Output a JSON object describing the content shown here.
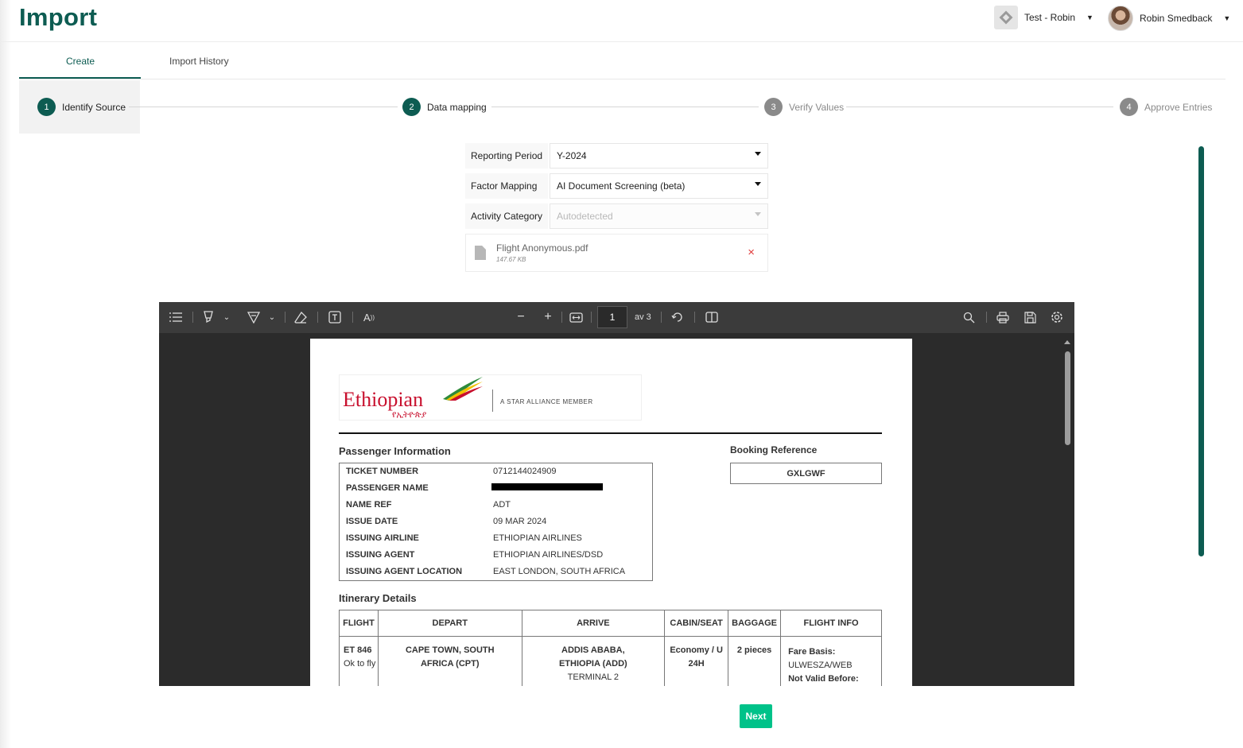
{
  "app": {
    "title": "Import"
  },
  "header": {
    "tenant": "Test - Robin",
    "user": "Robin Smedback"
  },
  "tabs": [
    {
      "label": "Create",
      "active": true
    },
    {
      "label": "Import History",
      "active": false
    }
  ],
  "steps": [
    {
      "number": "1",
      "label": "Identify Source",
      "state": "done"
    },
    {
      "number": "2",
      "label": "Data mapping",
      "state": "done"
    },
    {
      "number": "3",
      "label": "Verify Values",
      "state": "todo"
    },
    {
      "number": "4",
      "label": "Approve Entries",
      "state": "todo"
    }
  ],
  "form": {
    "reporting_period": {
      "label": "Reporting Period",
      "value": "Y-2024"
    },
    "factor_mapping": {
      "label": "Factor Mapping",
      "value": "AI Document Screening (beta)"
    },
    "activity_category": {
      "label": "Activity Category",
      "placeholder": "Autodetected"
    }
  },
  "file": {
    "name": "Flight Anonymous.pdf",
    "size": "147.67 KB",
    "remove_icon": "×"
  },
  "viewer": {
    "page_number": "1",
    "page_total": "av 3",
    "icons": [
      "list-icon",
      "highlight-icon",
      "draw-icon",
      "eraser-icon",
      "text-box-icon",
      "read-aloud-icon",
      "zoom-out-icon",
      "zoom-in-icon",
      "fit-width-icon",
      "rotate-icon",
      "two-page-icon",
      "search-icon",
      "print-icon",
      "save-icon",
      "settings-icon"
    ]
  },
  "document": {
    "logo_name": "Ethiopian",
    "logo_amharic": "የኢትዮጵያ",
    "logo_tagline": "A STAR ALLIANCE MEMBER",
    "passenger_title": "Passenger Information",
    "booking_title": "Booking Reference",
    "booking_ref": "GXLGWF",
    "passenger_info": [
      {
        "key": "TICKET NUMBER",
        "value": "0712144024909"
      },
      {
        "key": "PASSENGER NAME",
        "value": ""
      },
      {
        "key": "NAME REF",
        "value": "ADT"
      },
      {
        "key": "ISSUE DATE",
        "value": "09 MAR 2024"
      },
      {
        "key": "ISSUING AIRLINE",
        "value": "ETHIOPIAN AIRLINES"
      },
      {
        "key": "ISSUING AGENT",
        "value": "ETHIOPIAN AIRLINES/DSD"
      },
      {
        "key": "ISSUING AGENT LOCATION",
        "value": "EAST LONDON, SOUTH AFRICA"
      }
    ],
    "itinerary_title": "Itinerary Details",
    "itinerary_headers": [
      "FLIGHT",
      "DEPART",
      "ARRIVE",
      "CABIN/SEAT",
      "BAGGAGE",
      "FLIGHT INFO"
    ],
    "itinerary_row": {
      "flight": "ET 846",
      "flight_status": "Ok to fly",
      "depart_1": "CAPE TOWN, SOUTH",
      "depart_2": "AFRICA (CPT)",
      "arrive_1": "ADDIS ABABA,",
      "arrive_2": "ETHIOPIA (ADD)",
      "arrive_3": "TERMINAL 2",
      "cabin_1": "Economy / U",
      "cabin_2": "24H",
      "baggage": "2 pieces",
      "info_1": "Fare Basis:",
      "info_2": "ULWESZA/WEB",
      "info_3": "Not Valid Before:"
    }
  },
  "actions": {
    "next": "Next"
  },
  "colors": {
    "brand": "#0d5c52",
    "next": "#00c289",
    "danger": "#e03c3c"
  }
}
